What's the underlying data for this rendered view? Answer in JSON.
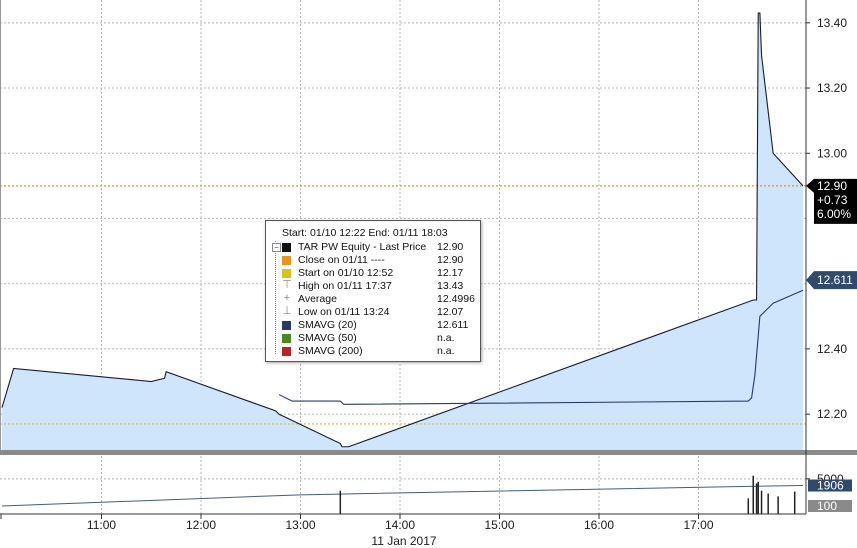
{
  "chart_data": {
    "type": "area",
    "date_label": "11 Jan 2017",
    "x_ticks": [
      "11:00",
      "12:00",
      "13:00",
      "14:00",
      "15:00",
      "16:00",
      "17:00"
    ],
    "y_ticks": [
      "12.20",
      "12.40",
      "13.00",
      "13.20",
      "13.40"
    ],
    "y_range": [
      12.09,
      13.47
    ],
    "grid": true,
    "series": [
      {
        "name": "TAR PW Equity - Last Price",
        "color": "#1a1a2e",
        "fill": "#cfe5fb",
        "points": [
          [
            "10:00",
            12.22
          ],
          [
            "10:07",
            12.34
          ],
          [
            "11:30",
            12.3
          ],
          [
            "11:38",
            12.31
          ],
          [
            "11:39",
            12.33
          ],
          [
            "12:45",
            12.21
          ],
          [
            "12:47",
            12.2
          ],
          [
            "13:24",
            12.11
          ],
          [
            "13:25",
            12.1
          ],
          [
            "13:29",
            12.1
          ],
          [
            "17:33",
            12.55
          ],
          [
            "17:35",
            12.55
          ],
          [
            "17:36",
            13.43
          ],
          [
            "17:37",
            13.43
          ],
          [
            "17:38",
            13.3
          ],
          [
            "17:45",
            13.0
          ],
          [
            "18:03",
            12.9
          ]
        ]
      },
      {
        "name": "SMAVG (20)",
        "color": "#243a6e",
        "points": [
          [
            "12:47",
            12.26
          ],
          [
            "12:55",
            12.24
          ],
          [
            "13:24",
            12.24
          ],
          [
            "13:26",
            12.23
          ],
          [
            "17:30",
            12.24
          ],
          [
            "17:32",
            12.25
          ],
          [
            "17:34",
            12.32
          ],
          [
            "17:37",
            12.5
          ],
          [
            "17:45",
            12.54
          ],
          [
            "18:03",
            12.58
          ]
        ]
      }
    ],
    "reference_lines": [
      {
        "name": "Close on 01/11",
        "value": 12.9,
        "color": "#e8951a"
      },
      {
        "name": "Start on 01/10 12:52",
        "value": 12.17,
        "color": "#d9c21a"
      }
    ],
    "price_tags": [
      {
        "label": "12.90",
        "sub": [
          "+0.73",
          "6.00%"
        ],
        "value": 12.9
      },
      {
        "label": "12.611",
        "value": 12.611
      }
    ],
    "volume_panel": {
      "y_ticks": [
        "5000",
        "1906",
        "100"
      ],
      "spikes": [
        {
          "time": "13:24",
          "value": 900
        },
        {
          "time": "17:30",
          "value": 300
        },
        {
          "time": "17:33",
          "value": 7800
        },
        {
          "time": "17:35",
          "value": 2600
        },
        {
          "time": "17:36",
          "value": 3300
        },
        {
          "time": "17:38",
          "value": 900
        },
        {
          "time": "17:42",
          "value": 600
        },
        {
          "time": "17:48",
          "value": 400
        },
        {
          "time": "17:58",
          "value": 800
        }
      ],
      "avg_line": [
        [
          "10:00",
          100
        ],
        [
          "13:00",
          500
        ],
        [
          "17:30",
          1700
        ],
        [
          "18:03",
          1906
        ]
      ]
    },
    "legend": {
      "range": "Start: 01/10 12:22 End: 01/11 18:03",
      "items": [
        {
          "label": "TAR PW Equity - Last Price",
          "value": "12.90",
          "marker": "square",
          "color": "#111111",
          "collapsible": true
        },
        {
          "label": "Close on 01/11 ----",
          "value": "12.90",
          "marker": "square",
          "color": "#e8951a"
        },
        {
          "label": "Start on 01/10 12:52",
          "value": "12.17",
          "marker": "square",
          "color": "#d9c21a"
        },
        {
          "label": "High on 01/11 17:37",
          "value": "13.43",
          "marker": "glyph",
          "glyph": "⊤"
        },
        {
          "label": "Average",
          "value": "12.4996",
          "marker": "glyph",
          "glyph": "+"
        },
        {
          "label": "Low on 01/11 13:24",
          "value": "12.07",
          "marker": "glyph",
          "glyph": "⊥"
        },
        {
          "label": "SMAVG (20)",
          "value": "12.611",
          "marker": "square",
          "color": "#243a6e"
        },
        {
          "label": "SMAVG (50)",
          "value": "n.a.",
          "marker": "square",
          "color": "#4a8a1c"
        },
        {
          "label": "SMAVG (200)",
          "value": "n.a.",
          "marker": "square",
          "color": "#c0202a"
        }
      ]
    }
  }
}
